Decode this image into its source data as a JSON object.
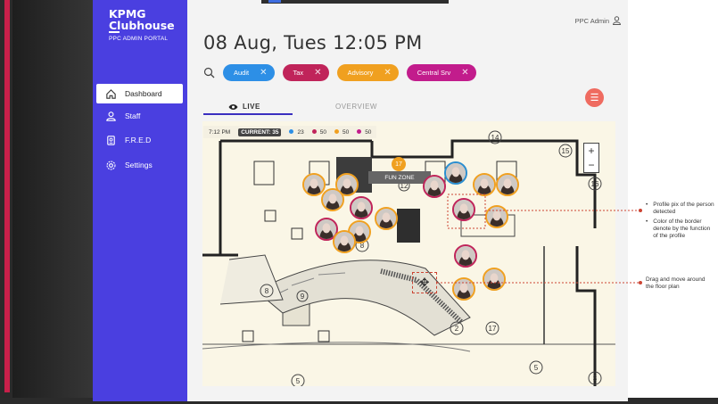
{
  "sidebar": {
    "brand_line1": "KPMG",
    "brand_line2": "Clubhouse",
    "portal": "PPC ADMIN PORTAL",
    "items": [
      {
        "label": "Dashboard",
        "icon": "home-icon",
        "active": true
      },
      {
        "label": "Staff",
        "icon": "person-icon",
        "active": false
      },
      {
        "label": "F.R.E.D",
        "icon": "fred-icon",
        "active": false
      },
      {
        "label": "Settings",
        "icon": "gear-icon",
        "active": false
      }
    ]
  },
  "header": {
    "admin_label": "PPC Admin",
    "datetime": "08 Aug, Tues 12:05  PM"
  },
  "filters": [
    {
      "label": "Audit",
      "color": "#2d8fe6"
    },
    {
      "label": "Tax",
      "color": "#c0245a"
    },
    {
      "label": "Advisory",
      "color": "#f0a020"
    },
    {
      "label": "Central Srv",
      "color": "#c21c8c"
    }
  ],
  "tabs": {
    "live": "LIVE",
    "overview": "OVERVIEW"
  },
  "live": {
    "time": "7:12 PM",
    "current": "CURRENT: 35",
    "counts": [
      {
        "value": "23",
        "color": "#2d8fe6"
      },
      {
        "value": "50",
        "color": "#c0245a"
      },
      {
        "value": "50",
        "color": "#f0a020"
      },
      {
        "value": "50",
        "color": "#c21c8c"
      }
    ]
  },
  "zone": {
    "count": "17",
    "label": "FUN ZONE"
  },
  "map_numbers": [
    "14",
    "15",
    "16",
    "12",
    "8",
    "8",
    "9",
    "2",
    "17",
    "5",
    "5",
    "3"
  ],
  "zoom": {
    "in": "+",
    "out": "−"
  },
  "annotations": {
    "profile_title": "Profile pix of the person detected",
    "profile_color": "Color of the border denote by the function of the profile",
    "drag": "Drag and move around the floor plan"
  }
}
